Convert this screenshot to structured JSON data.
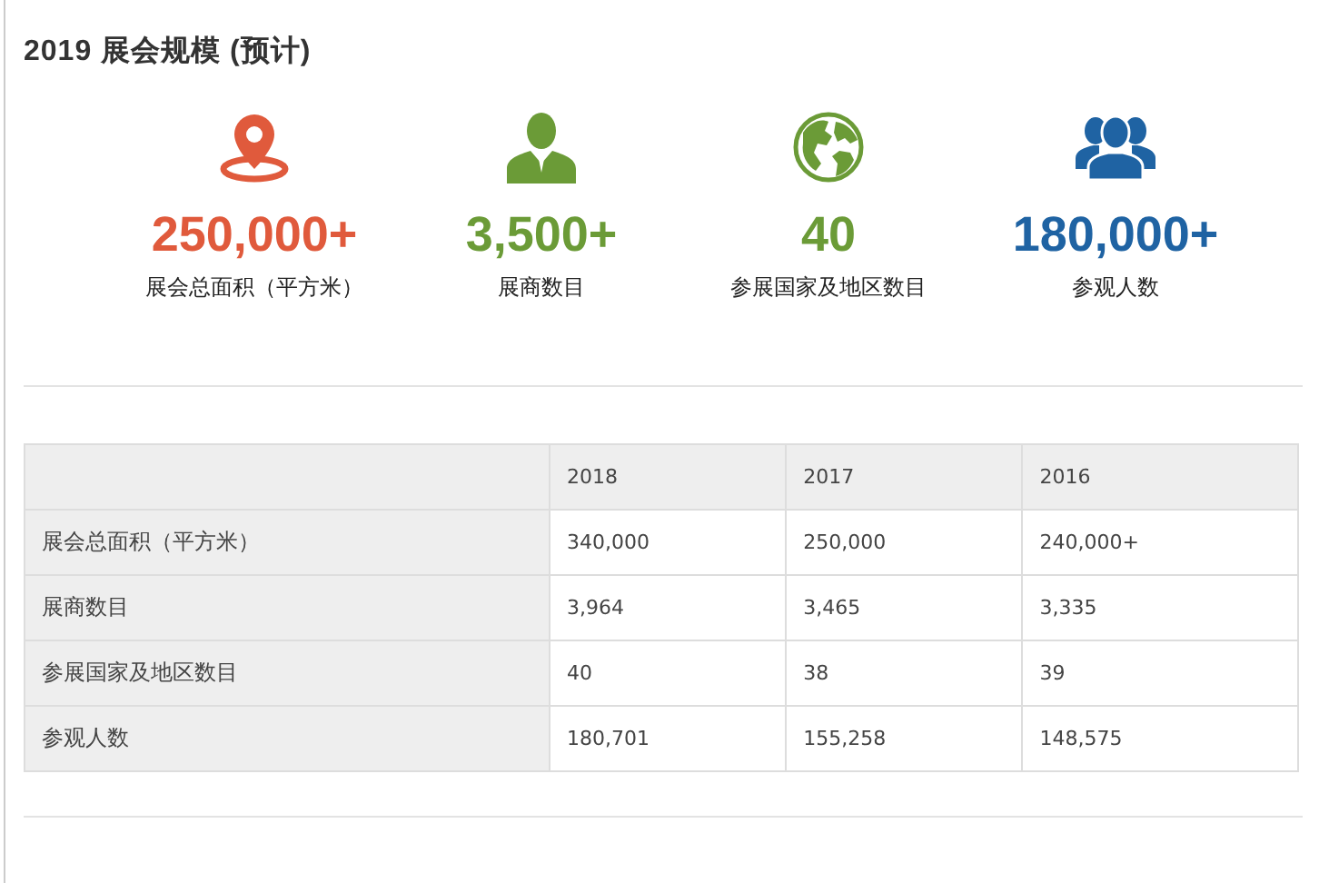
{
  "title": "2019 展会规模 (预计)",
  "stats": [
    {
      "kind": "pin",
      "color": "#e05a3c",
      "value": "250,000+",
      "label": "展会总面积（平方米）"
    },
    {
      "kind": "person",
      "color": "#6b9b37",
      "value": "3,500+",
      "label": "展商数目"
    },
    {
      "kind": "globe",
      "color": "#6b9b37",
      "value": "40",
      "label": "参展国家及地区数目"
    },
    {
      "kind": "people",
      "color": "#1f63a3",
      "value": "180,000+",
      "label": "参观人数"
    }
  ],
  "table": {
    "columns": [
      "2018",
      "2017",
      "2016"
    ],
    "rows": [
      {
        "label": "展会总面积（平方米）",
        "cells": [
          "340,000",
          "250,000",
          "240,000+"
        ]
      },
      {
        "label": "展商数目",
        "cells": [
          "3,964",
          "3,465",
          "3,335"
        ]
      },
      {
        "label": "参展国家及地区数目",
        "cells": [
          "40",
          "38",
          "39"
        ]
      },
      {
        "label": "参观人数",
        "cells": [
          "180,701",
          "155,258",
          "148,575"
        ]
      }
    ]
  }
}
